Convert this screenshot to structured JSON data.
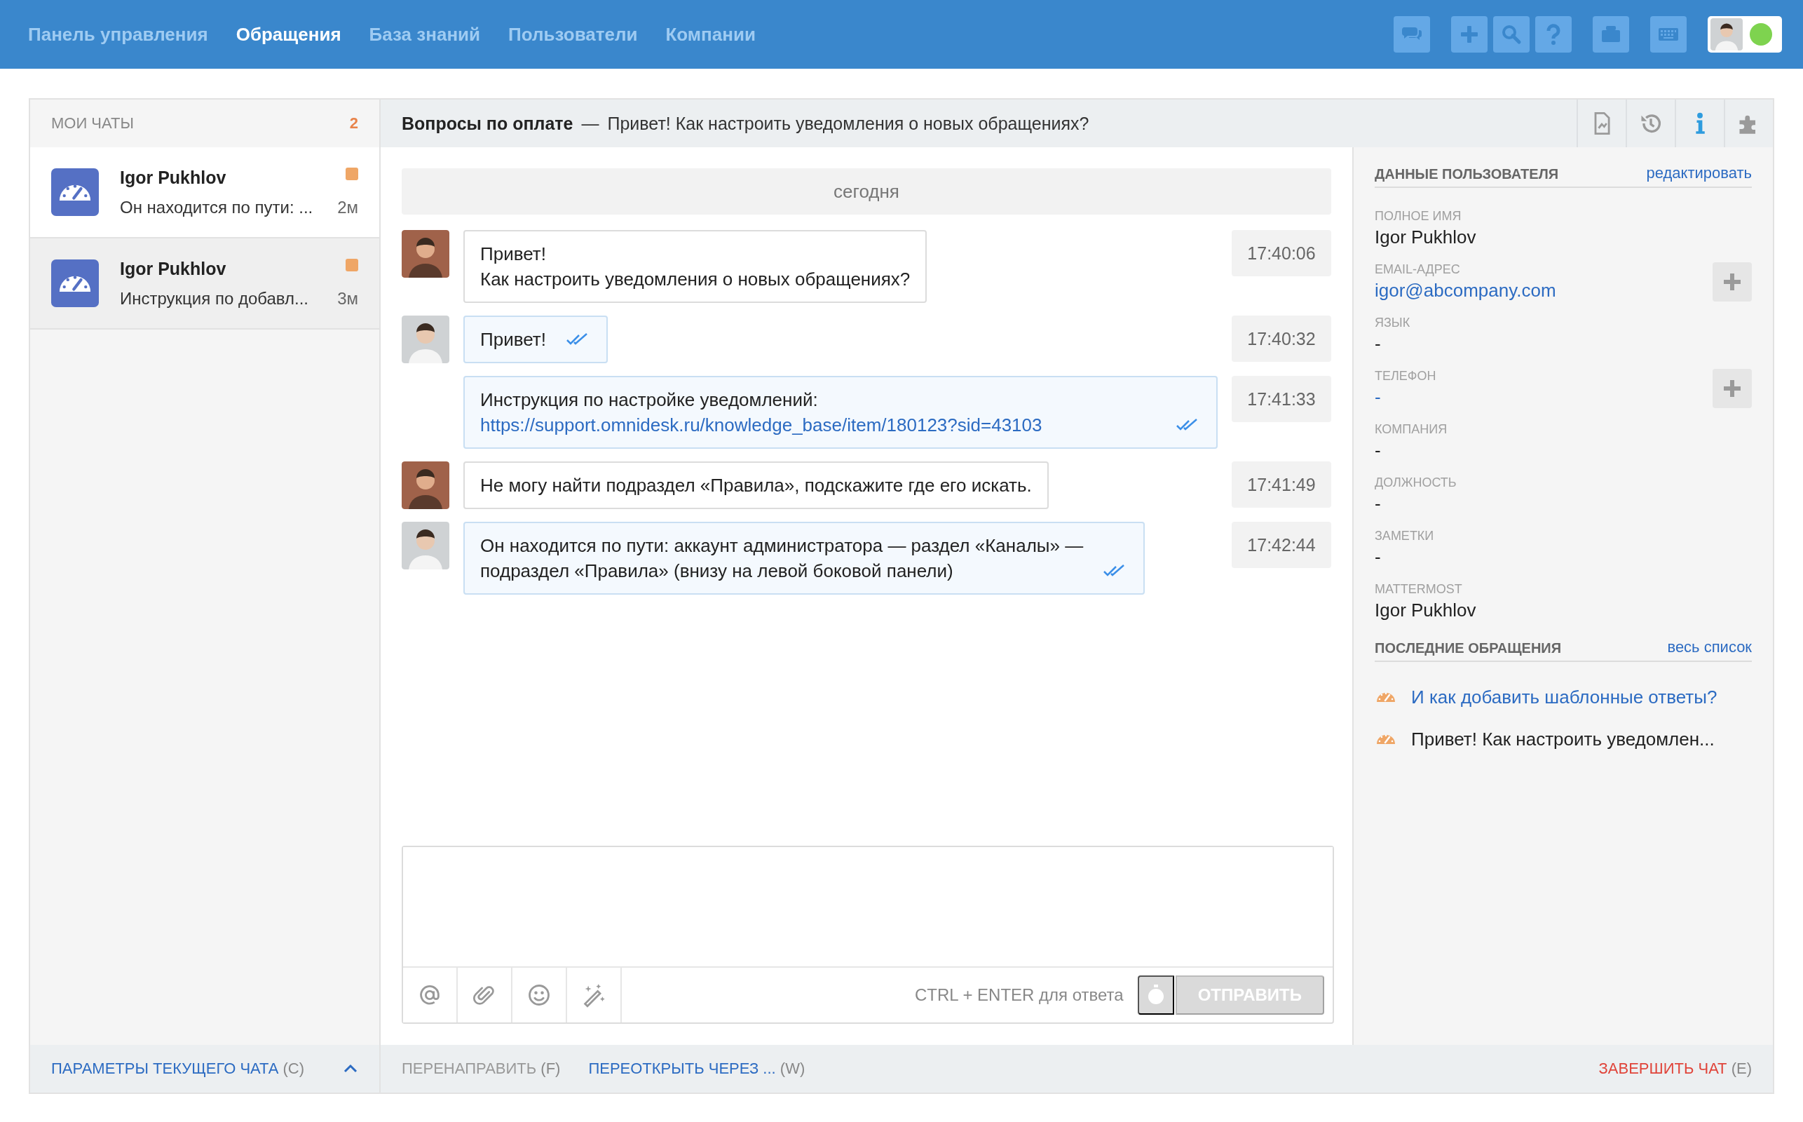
{
  "nav": [
    {
      "label": "Панель управления",
      "selected": false
    },
    {
      "label": "Обращения",
      "selected": true
    },
    {
      "label": "База знаний",
      "selected": false
    },
    {
      "label": "Пользователи",
      "selected": false
    },
    {
      "label": "Компании",
      "selected": false
    }
  ],
  "toolbar_groups": [
    {
      "icons": [
        {
          "kind": "chat"
        }
      ]
    },
    {
      "icons": [
        {
          "kind": "add"
        },
        {
          "kind": "search"
        },
        {
          "kind": "help"
        }
      ]
    },
    {
      "icons": [
        {
          "kind": "briefcase"
        }
      ]
    },
    {
      "icons": [
        {
          "kind": "keyboard"
        }
      ]
    }
  ],
  "profile": {
    "online": true
  },
  "chat_list": {
    "title": "МОИ ЧАТЫ",
    "count": "2",
    "items": [
      {
        "name": "Igor Pukhlov",
        "preview": "Он находится по пути: ...",
        "age": "2м",
        "selected": true
      },
      {
        "name": "Igor Pukhlov",
        "preview": "Инструкция по добавл...",
        "age": "3м",
        "selected": false
      }
    ]
  },
  "chat_header": {
    "subject": "Вопросы по оплате",
    "separator": "—",
    "title": "Привет! Как настроить уведомления о новых обращениях?"
  },
  "panel_tabs": [
    {
      "kind": "document",
      "selected": false
    },
    {
      "kind": "history",
      "selected": false
    },
    {
      "kind": "info",
      "selected": true
    },
    {
      "kind": "plugin",
      "selected": false
    }
  ],
  "date_separator": "сегодня",
  "messages": [
    {
      "kind": "client",
      "show_avatar": true,
      "lines": [
        "Привет!",
        "Как настроить уведомления о новых обращениях?"
      ],
      "read": false,
      "time": "17:40:06"
    },
    {
      "kind": "agent",
      "show_avatar": true,
      "lines": [
        "Привет!"
      ],
      "read": true,
      "time": "17:40:32"
    },
    {
      "kind": "agent",
      "show_avatar": false,
      "lines": [
        "Инструкция по настройке уведомлений:"
      ],
      "link": "https://support.omnidesk.ru/knowledge_base/item/180123?sid=43103",
      "read": true,
      "time": "17:41:33"
    },
    {
      "kind": "client",
      "show_avatar": true,
      "lines": [
        "Не могу найти подраздел «Правила», подскажите где его искать."
      ],
      "read": false,
      "time": "17:41:49"
    },
    {
      "kind": "agent",
      "show_avatar": true,
      "lines": [
        "Он находится по пути: аккаунт администратора — раздел «Каналы» —",
        "подраздел «Правила» (внизу на левой боковой панели)"
      ],
      "read": true,
      "time": "17:42:44"
    }
  ],
  "composer": {
    "tools": [
      {
        "kind": "mention"
      },
      {
        "kind": "attach"
      },
      {
        "kind": "emoji"
      },
      {
        "kind": "magic"
      }
    ],
    "hint": "CTRL + ENTER для ответа",
    "send": {
      "label": "ОТПРАВИТЬ",
      "disabled": true
    }
  },
  "user_data": {
    "title": "ДАННЫЕ ПОЛЬЗОВАТЕЛЯ",
    "action": "редактировать",
    "fields": [
      {
        "label": "ПОЛНОЕ ИМЯ",
        "value": "Igor Pukhlov",
        "link": false,
        "add_button": false
      },
      {
        "label": "EMAIL-АДРЕС",
        "value": "igor@abcompany.com",
        "link": true,
        "add_button": true
      },
      {
        "label": "ЯЗЫК",
        "value": "-",
        "link": false,
        "add_button": false
      },
      {
        "label": "ТЕЛЕФОН",
        "value": "-",
        "link": true,
        "add_button": true
      },
      {
        "label": "КОМПАНИЯ",
        "value": "-",
        "link": false,
        "add_button": false
      },
      {
        "label": "ДОЛЖНОСТЬ",
        "value": "-",
        "link": false,
        "add_button": false
      },
      {
        "label": "ЗАМЕТКИ",
        "value": "-",
        "link": false,
        "add_button": false
      },
      {
        "label": "MATTERMOST",
        "value": "Igor Pukhlov",
        "link": false,
        "add_button": false
      }
    ]
  },
  "recent": {
    "title": "ПОСЛЕДНИЕ ОБРАЩЕНИЯ",
    "action": "весь список",
    "items": [
      {
        "text": "И как добавить шаблонные ответы?",
        "current": false
      },
      {
        "text": "Привет! Как настроить уведомлен...",
        "current": true
      }
    ]
  },
  "footer_left": {
    "label": "ПАРАМЕТРЫ ТЕКУЩЕГО ЧАТА",
    "shortcut": "(C)",
    "expanded": false
  },
  "footer_actions": [
    {
      "label": "ПЕРЕНАПРАВИТЬ",
      "shortcut": "(F)",
      "kind": "disabled"
    },
    {
      "label": "ПЕРЕОТКРЫТЬ ЧЕРЕЗ ...",
      "shortcut": "(W)",
      "kind": "link"
    },
    {
      "label": "ЗАВЕРШИТЬ ЧАТ",
      "shortcut": "(E)",
      "kind": "danger"
    }
  ]
}
